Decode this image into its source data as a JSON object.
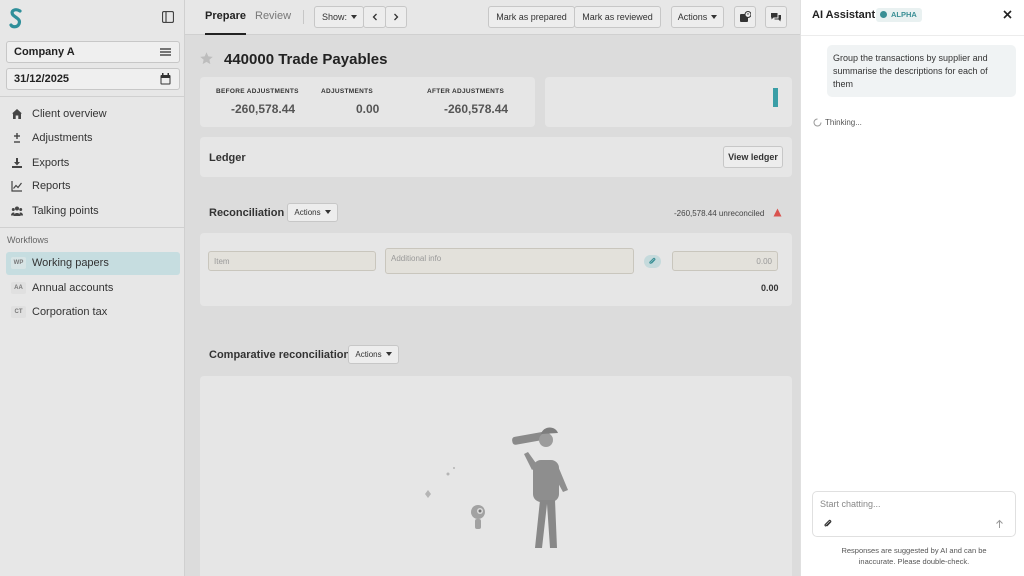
{
  "sidebar": {
    "company": "Company A",
    "date": "31/12/2025",
    "nav": [
      {
        "label": "Client overview",
        "icon": "home-icon"
      },
      {
        "label": "Adjustments",
        "icon": "plus-minus-icon"
      },
      {
        "label": "Exports",
        "icon": "download-icon"
      },
      {
        "label": "Reports",
        "icon": "chart-icon"
      },
      {
        "label": "Talking points",
        "icon": "people-icon"
      }
    ],
    "workflows_label": "Workflows",
    "workflows": [
      {
        "abbr": "WP",
        "label": "Working papers",
        "active": true
      },
      {
        "abbr": "AA",
        "label": "Annual accounts",
        "active": false
      },
      {
        "abbr": "CT",
        "label": "Corporation tax",
        "active": false
      }
    ]
  },
  "topbar": {
    "tabs": [
      "Prepare",
      "Review"
    ],
    "show_label": "Show:",
    "mark_prepared": "Mark as prepared",
    "mark_reviewed": "Mark as reviewed",
    "actions": "Actions"
  },
  "main": {
    "title": "440000 Trade Payables",
    "stats": [
      {
        "label": "BEFORE ADJUSTMENTS",
        "value": "-260,578.44"
      },
      {
        "label": "ADJUSTMENTS",
        "value": "0.00"
      },
      {
        "label": "AFTER ADJUSTMENTS",
        "value": "-260,578.44"
      }
    ],
    "ledger": {
      "title": "Ledger",
      "button": "View ledger"
    },
    "reconciliation": {
      "title": "Reconciliation",
      "actions": "Actions",
      "unreconciled": "-260,578.44 unreconciled",
      "item_placeholder": "Item",
      "info_placeholder": "Additional info",
      "amount_placeholder": "0.00",
      "total": "0.00"
    },
    "comparative": {
      "title": "Comparative reconciliation",
      "actions": "Actions"
    }
  },
  "assistant": {
    "title": "AI Assistant",
    "badge": "ALPHA",
    "user_message": "Group the transactions by supplier and summarise the descriptions for each of them",
    "status": "Thinking...",
    "input_placeholder": "Start chatting...",
    "disclaimer_line1": "Responses are suggested by AI and can be",
    "disclaimer_line2": "inaccurate. Please double-check."
  },
  "colors": {
    "accent": "#3a9ea6",
    "active_nav": "#c6dde0",
    "warning": "#d9534f"
  }
}
